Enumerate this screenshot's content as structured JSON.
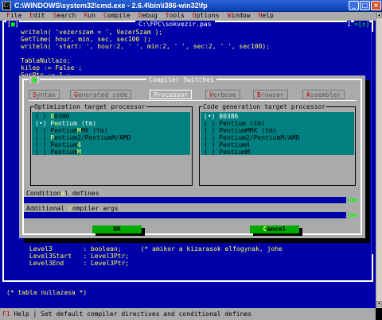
{
  "window": {
    "title": "C:\\WINDOWS\\system32\\cmd.exe - 2.6.4\\bin\\i386-win32\\fp",
    "icon_text": "C:\\",
    "controls": {
      "minimize": "_",
      "maximize": "□",
      "close": "×"
    }
  },
  "menu": [
    {
      "label": "File",
      "hotkey": "F",
      "rest": "ile"
    },
    {
      "label": "Edit",
      "hotkey": "E",
      "rest": "dit"
    },
    {
      "label": "Search",
      "hotkey": "S",
      "rest": "earch"
    },
    {
      "label": "Run",
      "hotkey": "R",
      "rest": "un"
    },
    {
      "label": "Compile",
      "hotkey": "C",
      "rest": "ompile"
    },
    {
      "label": "Debug",
      "hotkey": "D",
      "rest": "ebug"
    },
    {
      "label": "Tools",
      "hotkey": "T",
      "rest": "ools"
    },
    {
      "label": "Options",
      "hotkey": "O",
      "rest": "ptions"
    },
    {
      "label": "Window",
      "hotkey": "W",
      "rest": "indow"
    },
    {
      "label": "Help",
      "hotkey": "H",
      "rest": "elp"
    }
  ],
  "editor": {
    "close_box": "[■]",
    "title": "C:\\FPC\\sokvezir.pas",
    "window_number": "1",
    "arrows": "=[↕]",
    "lines_top": [
      "writeln( 'vezerszam = ', VezerSzam );",
      "GetTime( hour, min, sec, sec100 );",
      "writeln( 'start: ', hour:2, ' ', min:2, ' ', sec:2, ' ', sec100);",
      "",
      "TablaNullazo;",
      "kilep := False ;",
      "SorPtr := 1 ;"
    ],
    "lines_bottom": [
      "      Level3        : boolean;     (* amikor a kizarasok elfogynak, johe",
      "      Level3Start   : Level3Ptr;",
      "      Level3End     : Level3Ptr;"
    ],
    "comment_line": "(* tabla nullazasa *)"
  },
  "status_bar": {
    "hotkey": "F1",
    "text": " Help | Set default compiler directives and conditional defines"
  },
  "dialog": {
    "title": "Compiler Switches",
    "close_box": "[■]",
    "tabs": [
      {
        "hotkey": "S",
        "rest": "yntax"
      },
      {
        "hotkey": "G",
        "rest": "enerated code"
      },
      {
        "hotkey": "",
        "rest": "Processor"
      },
      {
        "hotkey": "V",
        "rest": "erbose"
      },
      {
        "hotkey": "B",
        "rest": "rowser"
      },
      {
        "hotkey": "A",
        "rest": "ssembler"
      }
    ],
    "optimization_group": {
      "label": "Optimization target processor",
      "options": [
        {
          "mark": "( )",
          "text": "80386",
          "hotkey_index": 0
        },
        {
          "mark": "(•)",
          "text": "Pentium (tm)",
          "hotkey_index": 1
        },
        {
          "mark": "( )",
          "text": "PentiumMMX (tm)",
          "hotkey_index": 7
        },
        {
          "mark": "( )",
          "text": "Pentium2/PentiumM/AMD",
          "hotkey_index": 0
        },
        {
          "mark": "( )",
          "text": "Pentium4",
          "hotkey_index": 7
        },
        {
          "mark": "( )",
          "text": "PentiumM",
          "hotkey_index": 7
        }
      ]
    },
    "codegen_group": {
      "label": "Code generation target processor",
      "options": [
        {
          "mark": "(•)",
          "text": "80386"
        },
        {
          "mark": "( )",
          "text": "Pentium (tm)"
        },
        {
          "mark": "( )",
          "text": "PentiumMMX (tm)"
        },
        {
          "mark": "( )",
          "text": "Pentium2/PentiumM/AMD"
        },
        {
          "mark": "( )",
          "text": "Pentium4"
        },
        {
          "mark": "( )",
          "text": "PentiumM"
        }
      ]
    },
    "conditional_defines": {
      "label": "Conditional defines",
      "hotkey_index": 9,
      "value": "",
      "end": "0▼↑"
    },
    "compiler_args": {
      "label": "Additional compiler args",
      "hotkey_index": 11,
      "value": "",
      "end": "0▼↑"
    },
    "ok_button": "OK",
    "cancel_button": "Cancel"
  },
  "colors": {
    "editor_bg": "#0000aa",
    "dialog_bg": "#aaaaaa",
    "list_bg": "#008080",
    "button_bg": "#00aa00",
    "keyword_yellow": "#ffff55"
  }
}
